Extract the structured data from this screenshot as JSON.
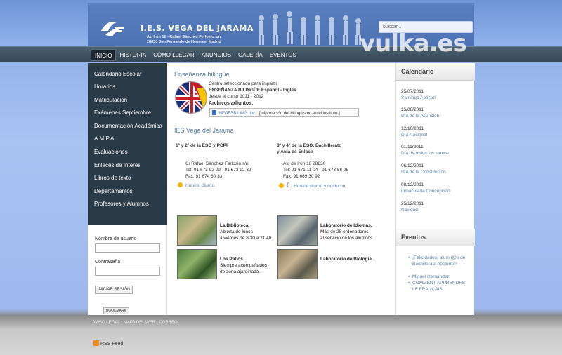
{
  "header": {
    "title": "I.E.S. VEGA DEL JARAMA",
    "address_line_1": "Av. Irún 18 - Rafael Sánchez Ferlosio s/n",
    "address_line_2": "28830 San Fernando de Henares, Madrid",
    "search_placeholder": "buscar..."
  },
  "watermark": "vulka.es",
  "nav": {
    "items": [
      "INICIO",
      "HISTORIA",
      "CÓMO LLEGAR",
      "ANUNCIOS",
      "GALERÍA",
      "EVENTOS"
    ],
    "active": "INICIO"
  },
  "sidebar": {
    "items": [
      "Calendario Escolar",
      "Horarios",
      "Matriculacion",
      "Exámenes Septiembre",
      "Documentación Académica",
      "A.M.P.A.",
      "Evaluaciones",
      "Enlaces de Interés",
      "Libros de texto",
      "Departamentos",
      "Profesores y Alumnos"
    ]
  },
  "login": {
    "username_label": "Nombre de usuario",
    "password_label": "Contraseña",
    "button_label": "INICIAR SESIÓN",
    "bookmark_label": "BOOKMARK"
  },
  "bilingual": {
    "title": "Enseñanza bilingüe",
    "line1": "Centro seleccionado para impartir",
    "line2": "ENSEÑANZA BILINGÜE Español - Inglés",
    "line3": "desde el curso 2011 - 2012",
    "attachments_label": "Archivos adjuntos:",
    "attachment_file": "INFOESBILING.doc",
    "attachment_desc": "[Información del bilingüismo en el instituto.]"
  },
  "ies": {
    "title": "IES Vega del Jarama",
    "col1": {
      "heading": "1º y 2º de la ESO y PCPI",
      "address": "C/ Rafael Sánchez Ferlosio s/n",
      "tel": "Tel: 91 673 92 29 - 91 673 92 32",
      "fax": "Fax: 91 674 60 33",
      "schedule": "Horario diurno."
    },
    "col2": {
      "heading1": "3º y 4º de la ESO, Bachillerato",
      "heading2": "y Aula de Enlace",
      "address": "Av/ de Irún 18 28830",
      "tel": "Tel: 91 671 11 04 - 91 673 56 25",
      "fax": "Fax: 91 669 30 92",
      "schedule": "Horario diurno y nocturno."
    }
  },
  "gallery": [
    {
      "title": "La Biblioteca.",
      "line1": "Abierta de lunes",
      "line2": "a viernes de 8:30 a 21:40"
    },
    {
      "title": "Laboratorio de Idiomas.",
      "line1": "Más de 25 ordenadores",
      "line2": "al servicio de los alumnos"
    },
    {
      "title": "Los Patios.",
      "line1": "Siempre acompañados",
      "line2": "de zona ajardinada."
    },
    {
      "title": "Laboratorio de Biología.",
      "line1": "",
      "line2": ""
    }
  ],
  "calendar": {
    "title": "Calendario",
    "entries": [
      {
        "date": "25/07/2011",
        "name": "Santiago Apóstol"
      },
      {
        "date": "15/08/2011",
        "name": "Día de la Asunción"
      },
      {
        "date": "12/10/2011",
        "name": "Día Nacional"
      },
      {
        "date": "01/11/2011",
        "name": "Día de todos los santos"
      },
      {
        "date": "06/12/2011",
        "name": "Día de la Constitución"
      },
      {
        "date": "08/12/2011",
        "name": "Inmaculada Concepción"
      },
      {
        "date": "25/12/2011",
        "name": "Navidad"
      }
    ]
  },
  "events": {
    "title": "Eventos",
    "items": [
      "¡Felicidades, alumn@s de Bachillerato nocturno!",
      "Miguel Hernández",
      "COMMENT APPRENDRE LE FRANÇAIS"
    ]
  },
  "footer": {
    "links": "* AVISO LEGAL * MAPA DEL WEB * CORREO",
    "rss": "RSS Feed"
  }
}
